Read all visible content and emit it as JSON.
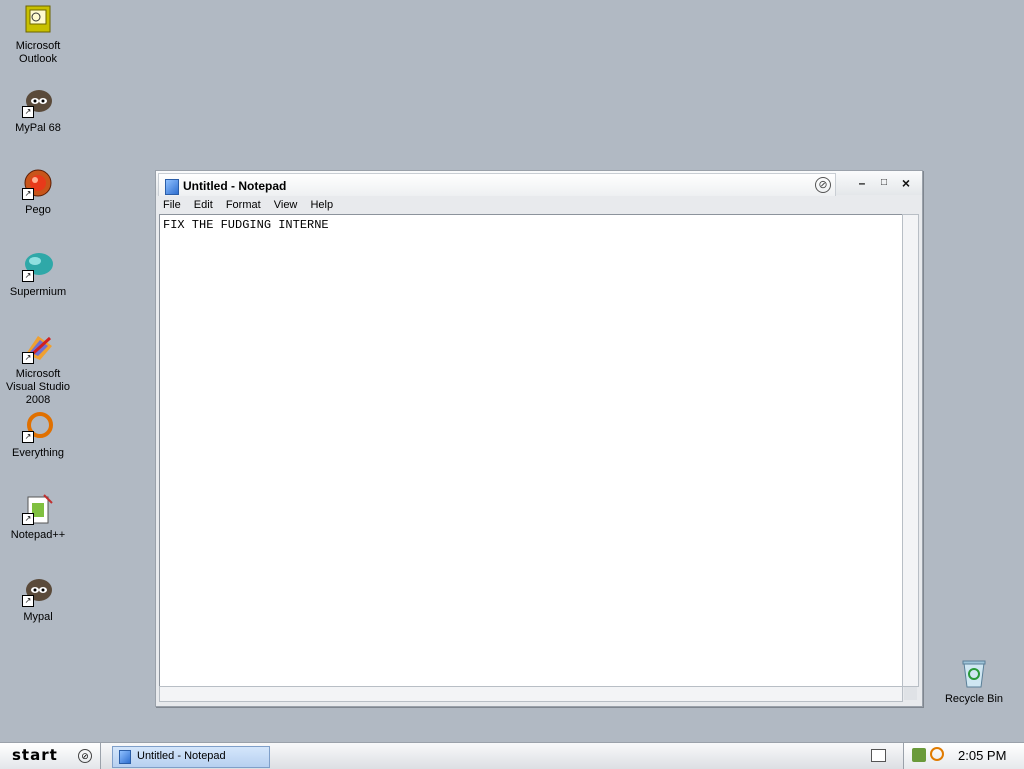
{
  "desktop": {
    "icons": [
      {
        "label": "Microsoft Outlook",
        "icon": "outlook-icon"
      },
      {
        "label": "MyPal 68",
        "icon": "mypal-icon"
      },
      {
        "label": "Pego",
        "icon": "pego-icon"
      },
      {
        "label": "Supermium",
        "icon": "supermium-icon"
      },
      {
        "label": "Microsoft Visual Studio 2008",
        "icon": "visual-studio-icon"
      },
      {
        "label": "Everything",
        "icon": "everything-icon"
      },
      {
        "label": "Notepad++",
        "icon": "notepadpp-icon"
      },
      {
        "label": "Mypal",
        "icon": "mypal-icon"
      },
      {
        "label": "Recycle Bin",
        "icon": "recycle-bin-icon"
      }
    ]
  },
  "window": {
    "title": "Untitled - Notepad",
    "menu": [
      "File",
      "Edit",
      "Format",
      "View",
      "Help"
    ],
    "content": "FIX THE FUDGING INTERNE",
    "controls": {
      "minimize": "–",
      "maximize": "□",
      "close": "×"
    }
  },
  "taskbar": {
    "start_label": "start",
    "task": "Untitled - Notepad",
    "clock": "2:05 PM"
  },
  "colors": {
    "desktop": "#b1b9c3",
    "taskbar_active": "#b7d0f0"
  }
}
